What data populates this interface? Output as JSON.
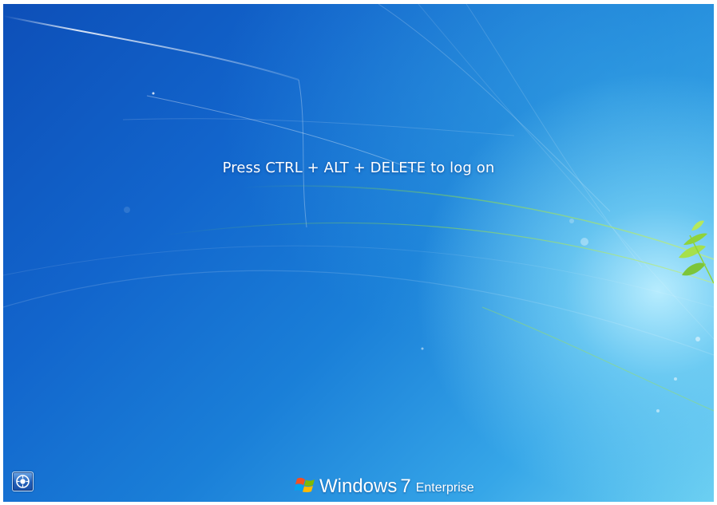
{
  "lock_screen": {
    "prompt": "Press CTRL + ALT + DELETE to log on"
  },
  "ease_of_access": {
    "icon": "ease-of-access-icon"
  },
  "branding": {
    "logo_icon": "windows-flag-icon",
    "word": "Windows",
    "version": "7",
    "edition": "Enterprise"
  },
  "colors": {
    "background_dark": "#0d4fb8",
    "background_light": "#6cd0f2",
    "text": "#ffffff",
    "leaf_green": "#8fd33a"
  }
}
